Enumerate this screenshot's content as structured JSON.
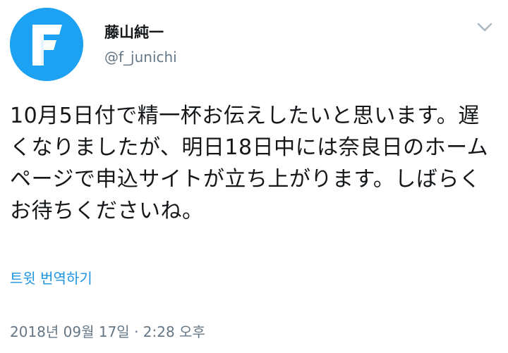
{
  "tweet": {
    "display_name": "藤山純一",
    "handle": "@f_junichi",
    "text": "10月5日付で精一杯お伝えしたいと思います。遅くなりましたが、明日18日中には奈良日のホームページで申込サイトが立ち上がります。しばらくお待ちくださいね。",
    "translate_label": "트윗 번역하기",
    "timestamp": "2018년 09월 17일 · 2:28 오후"
  },
  "icons": {
    "avatar": "letter-f-logo-avatar",
    "menu": "chevron-down-icon"
  },
  "colors": {
    "avatar_bg": "#1da1f2",
    "link": "#1b95e0",
    "secondary_text": "#657786",
    "primary_text": "#14171a"
  }
}
